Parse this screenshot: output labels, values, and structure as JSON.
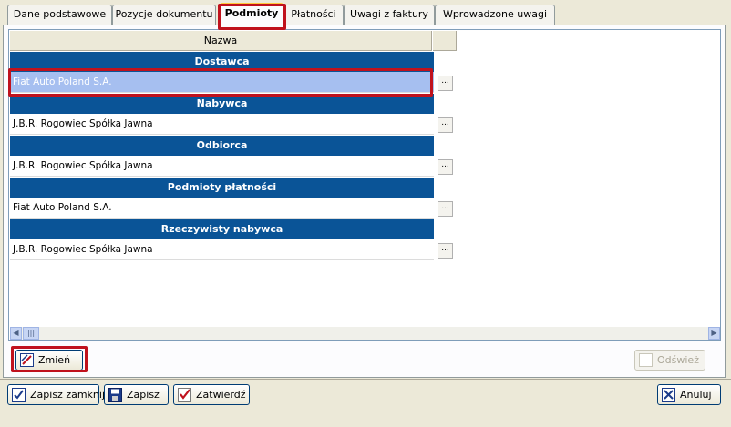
{
  "tabs": [
    {
      "label": "Dane podstawowe"
    },
    {
      "label": "Pozycje dokumentu"
    },
    {
      "label": "Podmioty"
    },
    {
      "label": "Płatności"
    },
    {
      "label": "Uwagi z faktury"
    },
    {
      "label": "Wprowadzone uwagi"
    }
  ],
  "grid": {
    "column_header": "Nazwa",
    "groups": [
      {
        "title": "Dostawca",
        "value": "Fiat Auto Poland S.A.",
        "button": "..."
      },
      {
        "title": "Nabywca",
        "value": "J.B.R. Rogowiec Spółka Jawna",
        "button": "..."
      },
      {
        "title": "Odbiorca",
        "value": "J.B.R. Rogowiec Spółka Jawna",
        "button": "..."
      },
      {
        "title": "Podmioty płatności",
        "value": "Fiat Auto Poland S.A.",
        "button": "..."
      },
      {
        "title": "Rzeczywisty nabywca",
        "value": "J.B.R. Rogowiec Spółka Jawna",
        "button": "..."
      }
    ]
  },
  "actions": {
    "change": "Zmień",
    "refresh": "Odśwież"
  },
  "footer": {
    "save_close": "Zapisz zamknij",
    "save": "Zapisz",
    "approve": "Zatwierdź",
    "cancel": "Anuluj"
  },
  "colors": {
    "group_header": "#0a5497",
    "selection": "#a6bff0",
    "highlight": "#c0121d"
  }
}
